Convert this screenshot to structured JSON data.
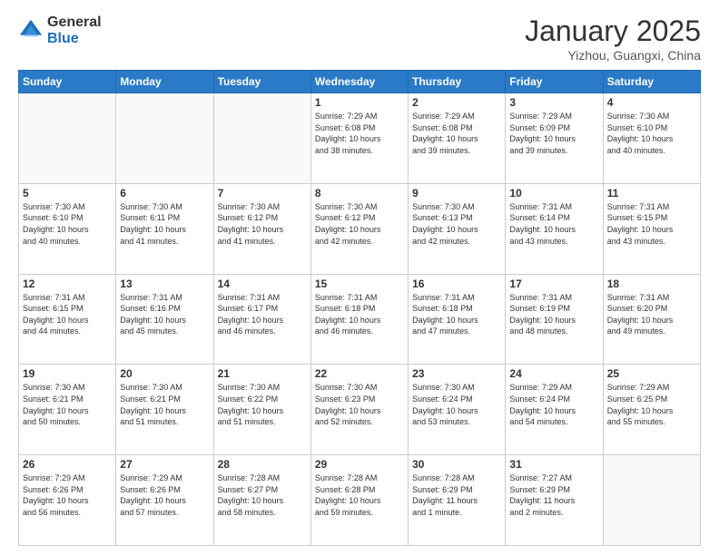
{
  "logo": {
    "general": "General",
    "blue": "Blue"
  },
  "header": {
    "month": "January 2025",
    "location": "Yizhou, Guangxi, China"
  },
  "weekdays": [
    "Sunday",
    "Monday",
    "Tuesday",
    "Wednesday",
    "Thursday",
    "Friday",
    "Saturday"
  ],
  "weeks": [
    [
      {
        "day": "",
        "info": ""
      },
      {
        "day": "",
        "info": ""
      },
      {
        "day": "",
        "info": ""
      },
      {
        "day": "1",
        "info": "Sunrise: 7:29 AM\nSunset: 6:08 PM\nDaylight: 10 hours\nand 38 minutes."
      },
      {
        "day": "2",
        "info": "Sunrise: 7:29 AM\nSunset: 6:08 PM\nDaylight: 10 hours\nand 39 minutes."
      },
      {
        "day": "3",
        "info": "Sunrise: 7:29 AM\nSunset: 6:09 PM\nDaylight: 10 hours\nand 39 minutes."
      },
      {
        "day": "4",
        "info": "Sunrise: 7:30 AM\nSunset: 6:10 PM\nDaylight: 10 hours\nand 40 minutes."
      }
    ],
    [
      {
        "day": "5",
        "info": "Sunrise: 7:30 AM\nSunset: 6:10 PM\nDaylight: 10 hours\nand 40 minutes."
      },
      {
        "day": "6",
        "info": "Sunrise: 7:30 AM\nSunset: 6:11 PM\nDaylight: 10 hours\nand 41 minutes."
      },
      {
        "day": "7",
        "info": "Sunrise: 7:30 AM\nSunset: 6:12 PM\nDaylight: 10 hours\nand 41 minutes."
      },
      {
        "day": "8",
        "info": "Sunrise: 7:30 AM\nSunset: 6:12 PM\nDaylight: 10 hours\nand 42 minutes."
      },
      {
        "day": "9",
        "info": "Sunrise: 7:30 AM\nSunset: 6:13 PM\nDaylight: 10 hours\nand 42 minutes."
      },
      {
        "day": "10",
        "info": "Sunrise: 7:31 AM\nSunset: 6:14 PM\nDaylight: 10 hours\nand 43 minutes."
      },
      {
        "day": "11",
        "info": "Sunrise: 7:31 AM\nSunset: 6:15 PM\nDaylight: 10 hours\nand 43 minutes."
      }
    ],
    [
      {
        "day": "12",
        "info": "Sunrise: 7:31 AM\nSunset: 6:15 PM\nDaylight: 10 hours\nand 44 minutes."
      },
      {
        "day": "13",
        "info": "Sunrise: 7:31 AM\nSunset: 6:16 PM\nDaylight: 10 hours\nand 45 minutes."
      },
      {
        "day": "14",
        "info": "Sunrise: 7:31 AM\nSunset: 6:17 PM\nDaylight: 10 hours\nand 46 minutes."
      },
      {
        "day": "15",
        "info": "Sunrise: 7:31 AM\nSunset: 6:18 PM\nDaylight: 10 hours\nand 46 minutes."
      },
      {
        "day": "16",
        "info": "Sunrise: 7:31 AM\nSunset: 6:18 PM\nDaylight: 10 hours\nand 47 minutes."
      },
      {
        "day": "17",
        "info": "Sunrise: 7:31 AM\nSunset: 6:19 PM\nDaylight: 10 hours\nand 48 minutes."
      },
      {
        "day": "18",
        "info": "Sunrise: 7:31 AM\nSunset: 6:20 PM\nDaylight: 10 hours\nand 49 minutes."
      }
    ],
    [
      {
        "day": "19",
        "info": "Sunrise: 7:30 AM\nSunset: 6:21 PM\nDaylight: 10 hours\nand 50 minutes."
      },
      {
        "day": "20",
        "info": "Sunrise: 7:30 AM\nSunset: 6:21 PM\nDaylight: 10 hours\nand 51 minutes."
      },
      {
        "day": "21",
        "info": "Sunrise: 7:30 AM\nSunset: 6:22 PM\nDaylight: 10 hours\nand 51 minutes."
      },
      {
        "day": "22",
        "info": "Sunrise: 7:30 AM\nSunset: 6:23 PM\nDaylight: 10 hours\nand 52 minutes."
      },
      {
        "day": "23",
        "info": "Sunrise: 7:30 AM\nSunset: 6:24 PM\nDaylight: 10 hours\nand 53 minutes."
      },
      {
        "day": "24",
        "info": "Sunrise: 7:29 AM\nSunset: 6:24 PM\nDaylight: 10 hours\nand 54 minutes."
      },
      {
        "day": "25",
        "info": "Sunrise: 7:29 AM\nSunset: 6:25 PM\nDaylight: 10 hours\nand 55 minutes."
      }
    ],
    [
      {
        "day": "26",
        "info": "Sunrise: 7:29 AM\nSunset: 6:26 PM\nDaylight: 10 hours\nand 56 minutes."
      },
      {
        "day": "27",
        "info": "Sunrise: 7:29 AM\nSunset: 6:26 PM\nDaylight: 10 hours\nand 57 minutes."
      },
      {
        "day": "28",
        "info": "Sunrise: 7:28 AM\nSunset: 6:27 PM\nDaylight: 10 hours\nand 58 minutes."
      },
      {
        "day": "29",
        "info": "Sunrise: 7:28 AM\nSunset: 6:28 PM\nDaylight: 10 hours\nand 59 minutes."
      },
      {
        "day": "30",
        "info": "Sunrise: 7:28 AM\nSunset: 6:29 PM\nDaylight: 11 hours\nand 1 minute."
      },
      {
        "day": "31",
        "info": "Sunrise: 7:27 AM\nSunset: 6:29 PM\nDaylight: 11 hours\nand 2 minutes."
      },
      {
        "day": "",
        "info": ""
      }
    ]
  ]
}
